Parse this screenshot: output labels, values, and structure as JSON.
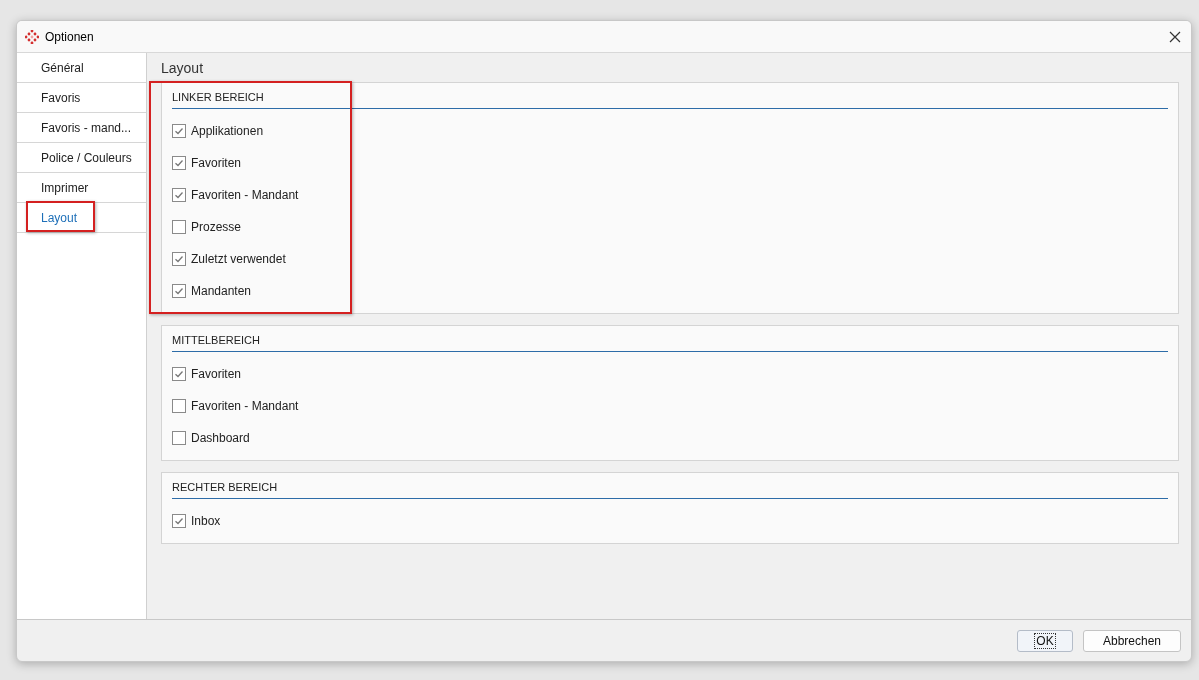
{
  "window": {
    "title": "Optionen"
  },
  "sidebar": {
    "items": [
      {
        "label": "Général",
        "selected": false,
        "highlighted": false
      },
      {
        "label": "Favoris",
        "selected": false,
        "highlighted": false
      },
      {
        "label": "Favoris - mand...",
        "selected": false,
        "highlighted": false
      },
      {
        "label": "Police / Couleurs",
        "selected": false,
        "highlighted": false
      },
      {
        "label": "Imprimer",
        "selected": false,
        "highlighted": false
      },
      {
        "label": "Layout",
        "selected": true,
        "highlighted": true
      }
    ]
  },
  "content": {
    "title": "Layout",
    "sections": [
      {
        "title": "LINKER BEREICH",
        "highlighted": true,
        "options": [
          {
            "label": "Applikationen",
            "checked": true
          },
          {
            "label": "Favoriten",
            "checked": true
          },
          {
            "label": "Favoriten - Mandant",
            "checked": true
          },
          {
            "label": "Prozesse",
            "checked": false
          },
          {
            "label": "Zuletzt verwendet",
            "checked": true
          },
          {
            "label": "Mandanten",
            "checked": true
          }
        ]
      },
      {
        "title": "MITTELBEREICH",
        "highlighted": false,
        "options": [
          {
            "label": "Favoriten",
            "checked": true
          },
          {
            "label": "Favoriten - Mandant",
            "checked": false
          },
          {
            "label": "Dashboard",
            "checked": false
          }
        ]
      },
      {
        "title": "RECHTER BEREICH",
        "highlighted": false,
        "options": [
          {
            "label": "Inbox",
            "checked": true
          }
        ]
      }
    ]
  },
  "buttons": [
    {
      "label": "OK",
      "focused": true
    },
    {
      "label": "Abbrechen",
      "focused": false
    }
  ]
}
